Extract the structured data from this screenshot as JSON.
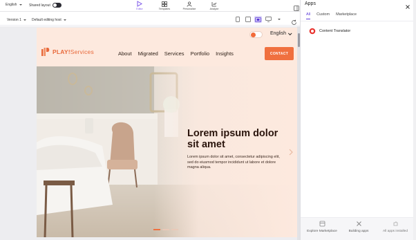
{
  "toolbar": {
    "language": "English",
    "shared_layout_label": "Shared layout",
    "modes": [
      {
        "label": "Editor",
        "icon": "editor-icon",
        "active": true
      },
      {
        "label": "Templates",
        "icon": "templates-icon",
        "active": false
      },
      {
        "label": "Personalize",
        "icon": "personalize-icon",
        "active": false
      },
      {
        "label": "Analyze",
        "icon": "analyze-icon",
        "active": false
      }
    ]
  },
  "subbar": {
    "version": "Version 1",
    "editing_host": "Default editing host"
  },
  "site": {
    "language": "English",
    "logo": {
      "brand": "PLAY!",
      "suffix": "Services"
    },
    "nav": [
      "About",
      "Migrated",
      "Services",
      "Portfolio",
      "Insights"
    ],
    "contact_label": "CONTACT",
    "hero": {
      "title": "Lorem ipsum dolor sit amet",
      "body": "Lorem ipsum dolor sit amet, consectetur adipiscing elit, sed do eiusmod tempor incididunt ut labore et dolore magna aliqua."
    }
  },
  "apps_panel": {
    "title": "Apps",
    "tabs": [
      {
        "label": "All",
        "active": true
      },
      {
        "label": "Custom",
        "active": false
      },
      {
        "label": "Marketplace",
        "active": false
      }
    ],
    "apps": [
      {
        "label": "Content Translator",
        "icon": "content-translator-icon"
      }
    ],
    "footer": [
      {
        "label": "Explore Marketplace",
        "icon": "marketplace-icon"
      },
      {
        "label": "Building apps",
        "icon": "tools-icon"
      },
      {
        "label": "All apps installed",
        "icon": "puzzle-icon"
      }
    ]
  },
  "colors": {
    "accent": "#7b55e8",
    "site_orange": "#f0703f",
    "site_bg": "#fde9de"
  }
}
